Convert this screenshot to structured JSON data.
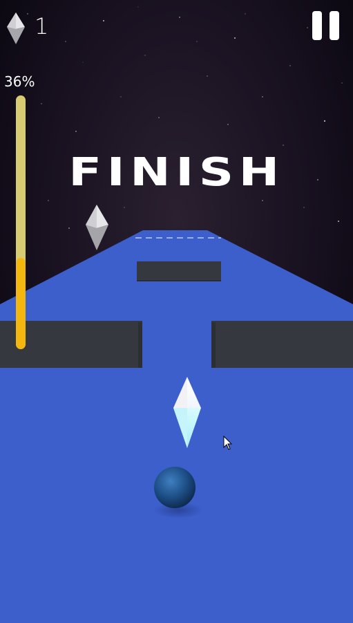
{
  "hud": {
    "gem_count": "1",
    "progress_label": "36%",
    "progress": 0.36
  },
  "finish_banner": "FINISH",
  "colors": {
    "track": "#3c5fcc",
    "obstacle": "#35393f",
    "progress_fill": "#f4b710",
    "progress_track": "#d8cc73",
    "ball": "#1e4f86",
    "gem": "#ffffff"
  },
  "icons": {
    "gem_counter": "diamond-icon",
    "pause": "pause-icon",
    "cursor": "mouse-cursor-icon"
  }
}
